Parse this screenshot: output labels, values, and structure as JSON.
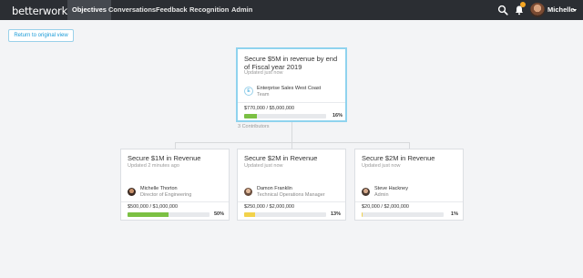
{
  "nav": {
    "logo": "betterworks",
    "items": [
      "Objectives",
      "Conversations",
      "Feedback",
      "Recognition",
      "Admin"
    ],
    "user": "Michelle",
    "accent": "#f5a623"
  },
  "return_button": "Return to original view",
  "parent": {
    "title": "Secure $5M in revenue by end of Fiscal year 2019",
    "updated": "Updated just now",
    "owner_name": "Enterprise Sales West Coast",
    "owner_role": "Team",
    "owner_initial": "E",
    "amount": "$770,000 / $5,000,000",
    "progress": 0.16,
    "percent": "16%",
    "bar_color": "#7bc043"
  },
  "contributors_label": "3 Contributors",
  "children": [
    {
      "title": "Secure $1M in Revenue",
      "updated": "Updated 2 minutes ago",
      "owner_name": "Michelle Thorton",
      "owner_role": "Director of Engineering",
      "amount": "$500,000 / $1,000,000",
      "progress": 0.5,
      "percent": "50%",
      "bar_color": "#7bc043"
    },
    {
      "title": "Secure $2M in Revenue",
      "updated": "Updated just now",
      "owner_name": "Damon Franklin",
      "owner_role": "Technical Operations Manager",
      "amount": "$250,000 / $2,000,000",
      "progress": 0.13,
      "percent": "13%",
      "bar_color": "#f2d24b"
    },
    {
      "title": "Secure $2M in Revenue",
      "updated": "Updated just now",
      "owner_name": "Steve Hackney",
      "owner_role": "Admin",
      "amount": "$20,000 / $2,000,000",
      "progress": 0.01,
      "percent": "1%",
      "bar_color": "#f2d24b"
    }
  ]
}
